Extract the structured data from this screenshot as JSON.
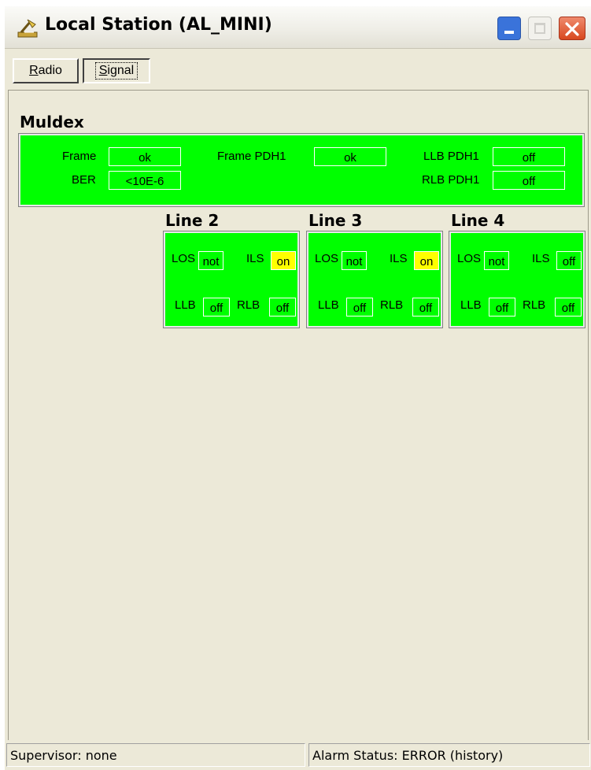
{
  "window": {
    "title": "Local Station (AL_MINI)",
    "icon": "station-icon",
    "controls": [
      "minimize-icon",
      "maximize-icon",
      "close-icon"
    ]
  },
  "tabs": [
    {
      "label_underlined": "R",
      "label_rest": "adio",
      "selected": false
    },
    {
      "label_underlined": "S",
      "label_rest": "ignal",
      "selected": true
    }
  ],
  "muldex": {
    "title": "Muldex",
    "frame_label": "Frame",
    "frame_value": "ok",
    "ber_label": "BER",
    "ber_value": "<10E-6",
    "frame_pdh1_label": "Frame PDH1",
    "frame_pdh1_value": "ok",
    "llb_pdh1_label": "LLB PDH1",
    "llb_pdh1_value": "off",
    "rlb_pdh1_label": "RLB PDH1",
    "rlb_pdh1_value": "off"
  },
  "lines": [
    {
      "title": "Line 2",
      "los_label": "LOS",
      "los": "not",
      "ils_label": "ILS",
      "ils": "on",
      "llb_label": "LLB",
      "llb": "off",
      "rlb_label": "RLB",
      "rlb": "off"
    },
    {
      "title": "Line 3",
      "los_label": "LOS",
      "los": "not",
      "ils_label": "ILS",
      "ils": "on",
      "llb_label": "LLB",
      "llb": "off",
      "rlb_label": "RLB",
      "rlb": "off"
    },
    {
      "title": "Line 4",
      "los_label": "LOS",
      "los": "not",
      "ils_label": "ILS",
      "ils": "off",
      "llb_label": "LLB",
      "llb": "off",
      "rlb_label": "RLB",
      "rlb": "off"
    }
  ],
  "colors": {
    "ok_green": "#00ff00",
    "alarm_yellow": "#ffff00",
    "close_red": "#d8481f",
    "face": "#ece9d8"
  },
  "statusbar": {
    "supervisor": "Supervisor: none",
    "alarm_status": "Alarm Status: ERROR (history)"
  }
}
